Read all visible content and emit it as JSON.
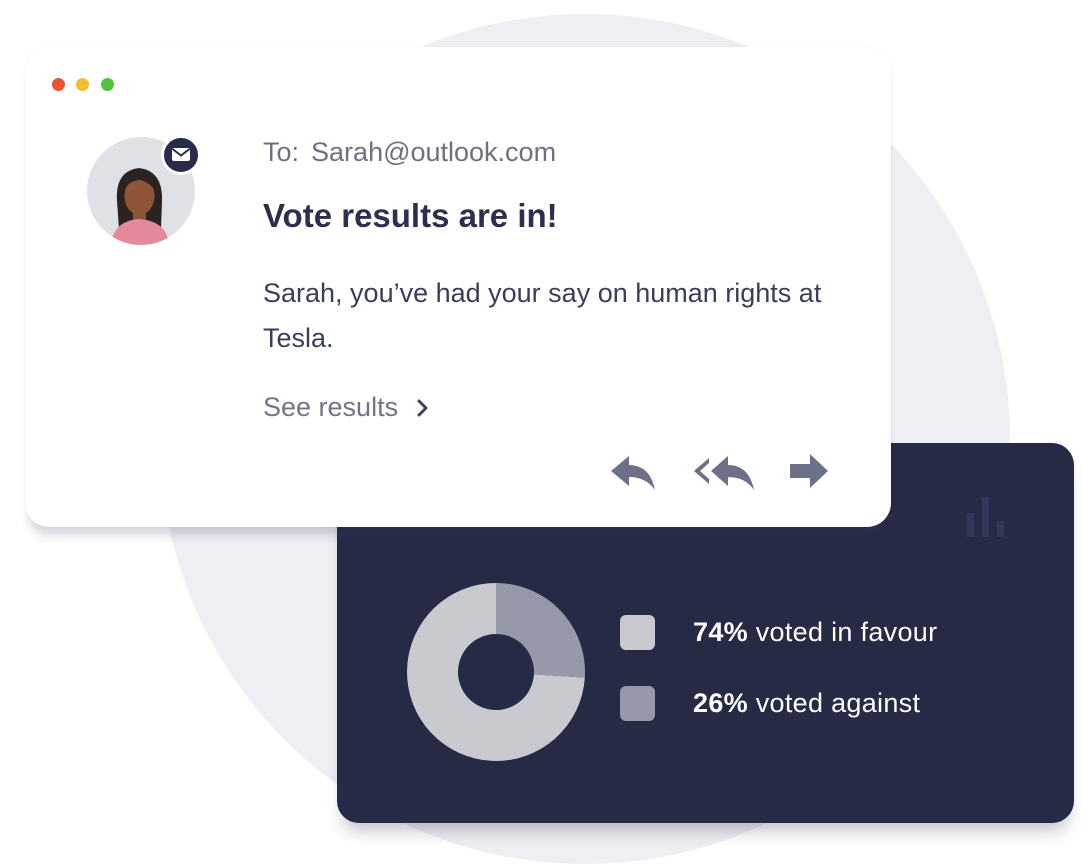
{
  "email": {
    "window_controls": [
      "close",
      "minimize",
      "maximize"
    ],
    "to_label": "To:",
    "to_address": "Sarah@outlook.com",
    "subject": "Vote results are in!",
    "body": "Sarah, you’ve had your say on human rights at Tesla.",
    "link_label": "See results",
    "actions": [
      {
        "name": "reply",
        "icon": "reply-icon"
      },
      {
        "name": "reply-all",
        "icon": "reply-all-icon"
      },
      {
        "name": "forward",
        "icon": "forward-icon"
      }
    ],
    "avatar_icon": "person-avatar",
    "badge_icon": "envelope-icon"
  },
  "results": {
    "icon": "bar-chart-icon",
    "items": [
      {
        "percent": "74%",
        "label": " voted in favour",
        "value": 74,
        "color": "#c9cad0"
      },
      {
        "percent": "26%",
        "label": " voted against",
        "value": 26,
        "color": "#9699a9"
      }
    ]
  },
  "colors": {
    "card_dark": "#262a45",
    "title_text": "#2c2f4e",
    "traffic_red": "#ec5233",
    "traffic_yellow": "#f3bf30",
    "traffic_green": "#50c23b"
  }
}
